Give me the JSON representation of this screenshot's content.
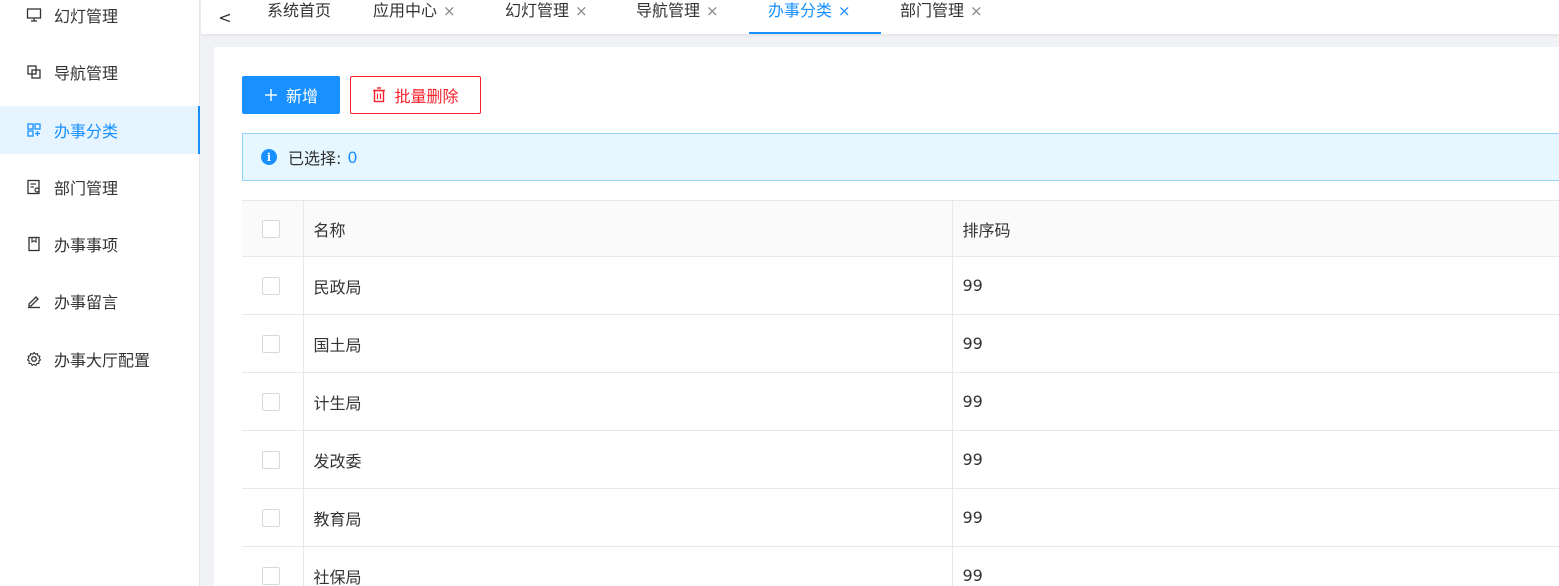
{
  "sidebar": {
    "items": [
      {
        "label": "幻灯管理",
        "icon": "monitor-icon"
      },
      {
        "label": "导航管理",
        "icon": "copy-icon"
      },
      {
        "label": "办事分类",
        "icon": "apps-icon",
        "active": true
      },
      {
        "label": "部门管理",
        "icon": "audit-icon"
      },
      {
        "label": "办事事项",
        "icon": "book-icon"
      },
      {
        "label": "办事留言",
        "icon": "edit-icon"
      },
      {
        "label": "办事大厅配置",
        "icon": "gear-icon"
      }
    ]
  },
  "tabs": {
    "back": "<",
    "items": [
      {
        "label": "系统首页",
        "closable": false
      },
      {
        "label": "应用中心",
        "closable": true
      },
      {
        "label": "幻灯管理",
        "closable": true
      },
      {
        "label": "导航管理",
        "closable": true
      },
      {
        "label": "办事分类",
        "closable": true,
        "active": true
      },
      {
        "label": "部门管理",
        "closable": true
      }
    ],
    "close_glyph": "×"
  },
  "toolbar": {
    "add_label": "新增",
    "batch_delete_label": "批量删除"
  },
  "alert": {
    "prefix": "已选择:",
    "count": "0"
  },
  "table": {
    "headers": [
      "名称",
      "排序码"
    ],
    "rows": [
      {
        "name": "民政局",
        "sort": "99"
      },
      {
        "name": "国土局",
        "sort": "99"
      },
      {
        "name": "计生局",
        "sort": "99"
      },
      {
        "name": "发改委",
        "sort": "99"
      },
      {
        "name": "教育局",
        "sort": "99"
      },
      {
        "name": "社保局",
        "sort": "99"
      }
    ]
  },
  "colors": {
    "primary": "#1890ff",
    "danger": "#f5222d",
    "alert_bg": "#e6f7ff"
  }
}
